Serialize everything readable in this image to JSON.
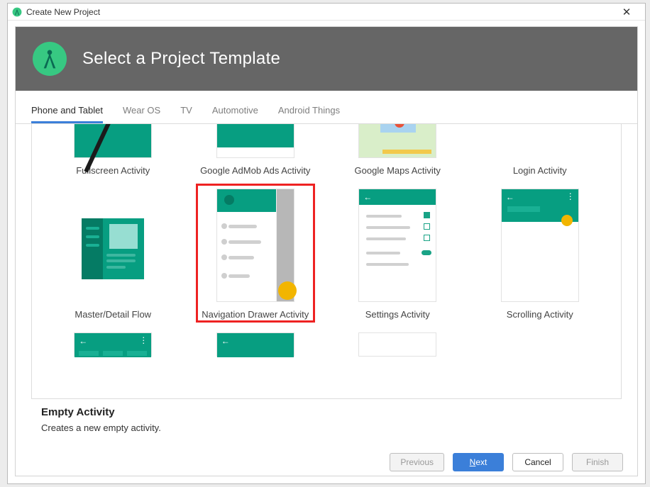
{
  "window": {
    "title": "Create New Project"
  },
  "banner": {
    "heading": "Select a Project Template"
  },
  "tabs": [
    {
      "label": "Phone and Tablet",
      "active": true
    },
    {
      "label": "Wear OS"
    },
    {
      "label": "TV"
    },
    {
      "label": "Automotive"
    },
    {
      "label": "Android Things"
    }
  ],
  "templates": {
    "fullscreen": {
      "label": "Fullscreen Activity"
    },
    "admob": {
      "label": "Google AdMob Ads Activity"
    },
    "maps": {
      "label": "Google Maps Activity"
    },
    "login": {
      "label": "Login Activity"
    },
    "masterdetail": {
      "label": "Master/Detail Flow"
    },
    "navdrawer": {
      "label": "Navigation Drawer Activity",
      "selected": true
    },
    "settings": {
      "label": "Settings Activity"
    },
    "scrolling": {
      "label": "Scrolling Activity"
    }
  },
  "description": {
    "title": "Empty Activity",
    "body": "Creates a new empty activity."
  },
  "buttons": {
    "previous": "Previous",
    "next_pre": "",
    "next_key": "N",
    "next_post": "ext",
    "cancel": "Cancel",
    "finish": "Finish"
  }
}
